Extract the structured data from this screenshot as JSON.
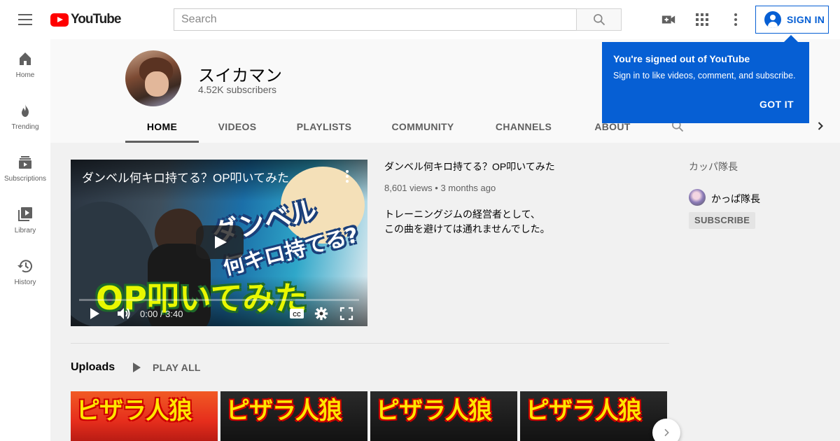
{
  "masthead": {
    "logo_text": "YouTube",
    "search_placeholder": "Search",
    "signin_label": "SIGN IN",
    "icons": [
      "menu-icon",
      "search-icon",
      "video-camera-icon",
      "apps-grid-icon",
      "more-vert-icon",
      "account-circle-icon"
    ]
  },
  "sidebar": {
    "items": [
      {
        "label": "Home",
        "icon": "home-icon"
      },
      {
        "label": "Trending",
        "icon": "flame-icon"
      },
      {
        "label": "Subscriptions",
        "icon": "subscriptions-icon"
      },
      {
        "label": "Library",
        "icon": "library-icon"
      },
      {
        "label": "History",
        "icon": "history-icon"
      }
    ]
  },
  "channel": {
    "name": "スイカマン",
    "subscribers": "4.52K subscribers",
    "tabs": [
      "HOME",
      "VIDEOS",
      "PLAYLISTS",
      "COMMUNITY",
      "CHANNELS",
      "ABOUT"
    ],
    "active_tab": "HOME"
  },
  "popup": {
    "title": "You're signed out of YouTube",
    "body": "Sign in to like videos, comment, and subscribe.",
    "button": "GOT IT"
  },
  "featured_video": {
    "player_title": "ダンベル何キロ持てる？OP叩いてみた",
    "time": "0:00 / 3:40",
    "thumb_text_top": "ダンベル",
    "thumb_text_mid": "何キロ持てる?",
    "thumb_text_bottom": "OP叩いてみた",
    "title": "ダンベル何キロ持てる？OP叩いてみた",
    "views": "8,601 views",
    "age": "3 months ago",
    "description_line1": "トレーニングジムの経営者として、",
    "description_line2": "この曲を避けては通れませんでした。"
  },
  "uploads": {
    "title": "Uploads",
    "play_all": "PLAY ALL",
    "thumbnails": [
      {
        "text": "ピザラ人狼"
      },
      {
        "text": "ピザラ人狼"
      },
      {
        "text": "ピザラ人狼"
      },
      {
        "text": "ピザラ人狼"
      }
    ]
  },
  "featured_channels": {
    "title": "カッパ隊長",
    "channel_name": "かっぱ隊長",
    "subscribe_label": "SUBSCRIBE"
  },
  "colors": {
    "brand_red": "#ff0000",
    "accent_blue": "#065fd4",
    "text_secondary": "#606060"
  }
}
